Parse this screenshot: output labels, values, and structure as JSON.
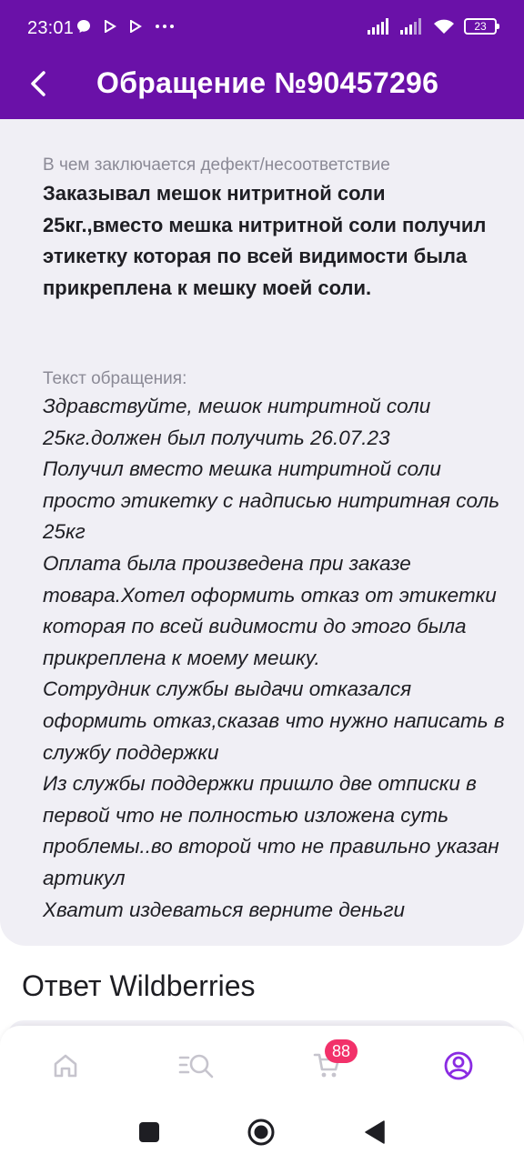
{
  "status_bar": {
    "time": "23:01",
    "battery": "23",
    "icons": [
      "messenger-icon",
      "play-icon",
      "play-icon",
      "more-dots-icon",
      "signal-icon",
      "signal-icon",
      "wifi-icon",
      "battery-icon"
    ]
  },
  "header": {
    "title": "Обращение №90457296",
    "back_icon": "chevron-left-icon",
    "background": "#6a11a8"
  },
  "defect": {
    "label": "В чем заключается дефект/несоответствие",
    "text": "Заказывал мешок нитритной соли 25кг.,вместо мешка нитритной соли получил этикетку которая по всей видимости была прикреплена к мешку моей соли."
  },
  "appeal": {
    "label": "Текст обращения:",
    "text": "Здравствуйте, мешок нитритной соли 25кг.должен был получить 26.07.23\nПолучил вместо мешка нитритной соли просто этикетку с надписью нитритная соль 25кг\nОплата была произведена при заказе товара.Хотел оформить отказ от этикетки которая по всей видимости до этого была прикреплена к моему мешку.\nСотрудник службы выдачи отказался оформить отказ,сказав что нужно написать в службу поддержки\nИз службы поддержки пришло две отписки в первой что не полностью изложена суть проблемы..во второй что не правильно указан артикул\nХватит издеваться верните деньги"
  },
  "answer": {
    "title": "Ответ Wildberries"
  },
  "bottom_nav": {
    "items": [
      "home-icon",
      "catalog-search-icon",
      "cart-icon",
      "profile-icon"
    ],
    "cart_badge": "88",
    "active": "profile-icon",
    "active_color": "#8a2be2",
    "badge_color": "#f2316a"
  },
  "system_nav": {
    "buttons": [
      "recents-icon",
      "home-circle-icon",
      "back-triangle-icon"
    ]
  }
}
